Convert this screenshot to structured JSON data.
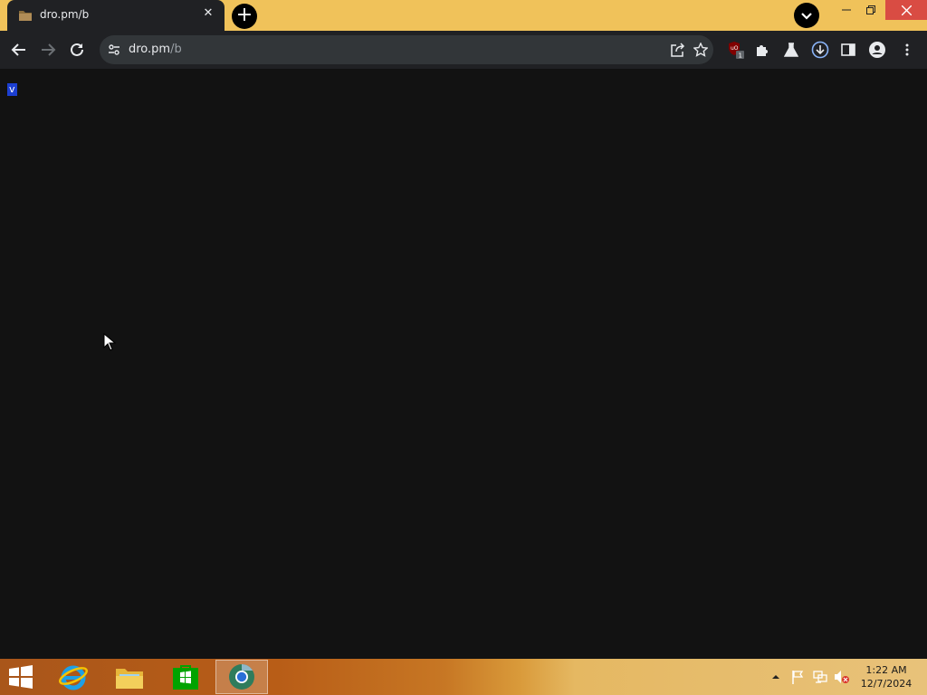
{
  "browser": {
    "tab": {
      "title": "dro.pm/b",
      "close_glyph": "✕",
      "favicon": "folder-icon"
    },
    "new_tab_glyph": "+",
    "address": {
      "host": "dro.pm",
      "path": "/b"
    },
    "extension_badge": "1",
    "icons": [
      "back-icon",
      "forward-icon",
      "reload-icon",
      "site-info-icon",
      "share-icon",
      "star-icon",
      "ublock-icon",
      "extensions-icon",
      "labs-icon",
      "download-icon",
      "side-panel-icon",
      "profile-icon",
      "menu-icon"
    ]
  },
  "page": {
    "selected_text": "v"
  },
  "taskbar": {
    "apps": [
      "internet-explorer-icon",
      "file-explorer-icon",
      "store-icon",
      "chrome-icon"
    ],
    "clock": {
      "time": "1:22 AM",
      "date": "12/7/2024"
    }
  },
  "colors": {
    "title_bar": "#f0c25a",
    "toolbar": "#202124",
    "page_bg": "#121212",
    "close_red": "#d94c43",
    "selection": "#1c3fd1"
  }
}
